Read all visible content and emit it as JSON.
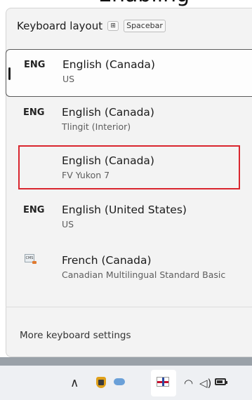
{
  "top_partial_text": "Enabling",
  "header": {
    "title": "Keyboard layout",
    "shortcut": "Spacebar"
  },
  "layouts": [
    {
      "tag": "ENG",
      "language": "English (Canada)",
      "layout": "US",
      "selected": true
    },
    {
      "tag": "ENG",
      "language": "English (Canada)",
      "layout": "Tlingit (Interior)",
      "selected": false
    },
    {
      "tag": "",
      "language": "English (Canada)",
      "layout": "FV Yukon 7",
      "selected": false,
      "highlighted": true
    },
    {
      "tag": "ENG",
      "language": "English (United States)",
      "layout": "US",
      "selected": false
    },
    {
      "tag": "",
      "language": "French (Canada)",
      "layout": "Canadian Multilingual Standard Basic",
      "selected": false,
      "icon": "ime-icon"
    }
  ],
  "footer": {
    "more_settings": "More keyboard settings"
  },
  "taskbar": {
    "chevron": "∧",
    "icons": [
      "chevron-up-icon",
      "security-shield-icon",
      "onedrive-sync-icon",
      "language-flag-icon",
      "wifi-icon",
      "volume-icon",
      "battery-icon"
    ]
  },
  "colors": {
    "highlight": "#d9262e",
    "background": "#f3f3f3"
  }
}
